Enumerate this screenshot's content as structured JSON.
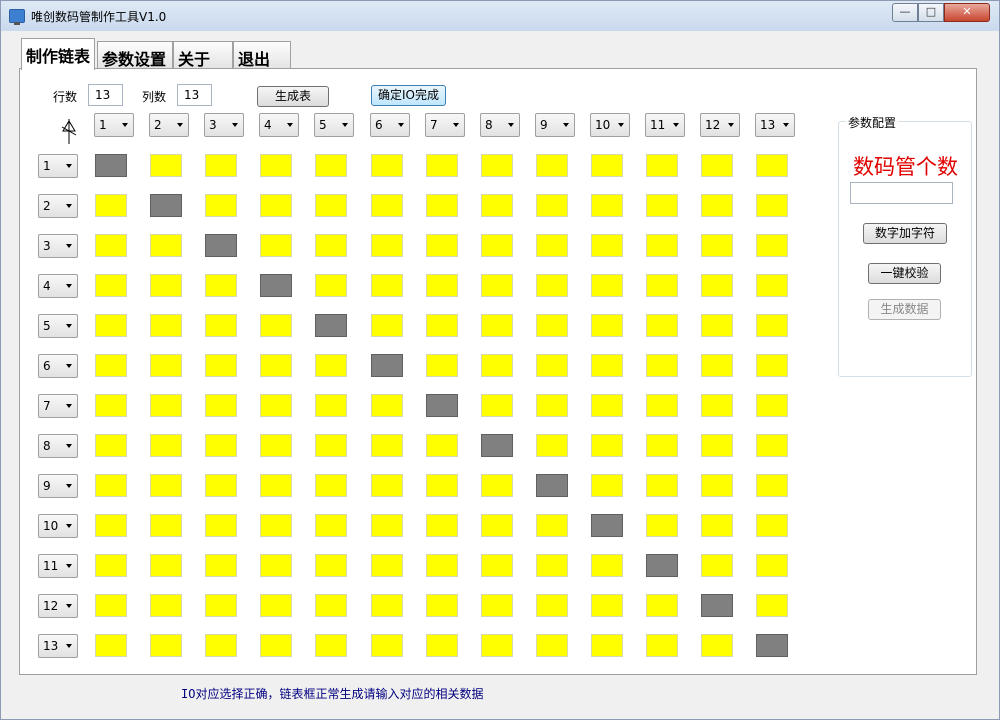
{
  "window": {
    "title": "唯创数码管制作工具V1.0"
  },
  "tabs": [
    {
      "label": "制作链表"
    },
    {
      "label": "参数设置"
    },
    {
      "label": "关于"
    },
    {
      "label": "退出"
    }
  ],
  "toolbar": {
    "rows_label": "行数",
    "rows_value": "13",
    "cols_label": "列数",
    "cols_value": "13",
    "generate_table_label": "生成表",
    "confirm_io_label": "确定IO完成"
  },
  "grid": {
    "columns": [
      "1",
      "2",
      "3",
      "4",
      "5",
      "6",
      "7",
      "8",
      "9",
      "10",
      "11",
      "12",
      "13"
    ],
    "rows": [
      "1",
      "2",
      "3",
      "4",
      "5",
      "6",
      "7",
      "8",
      "9",
      "10",
      "11",
      "12",
      "13"
    ],
    "colors": {
      "on": "#808080",
      "off": "#ffff00"
    }
  },
  "params_group": {
    "title": "参数配置",
    "digit_count_label": "数码管个数",
    "digit_count_value": "",
    "add_chars_label": "数字加字符",
    "verify_label": "一键校验",
    "generate_data_label": "生成数据"
  },
  "status": {
    "message": "IO对应选择正确，链表框正常生成请输入对应的相关数据"
  }
}
